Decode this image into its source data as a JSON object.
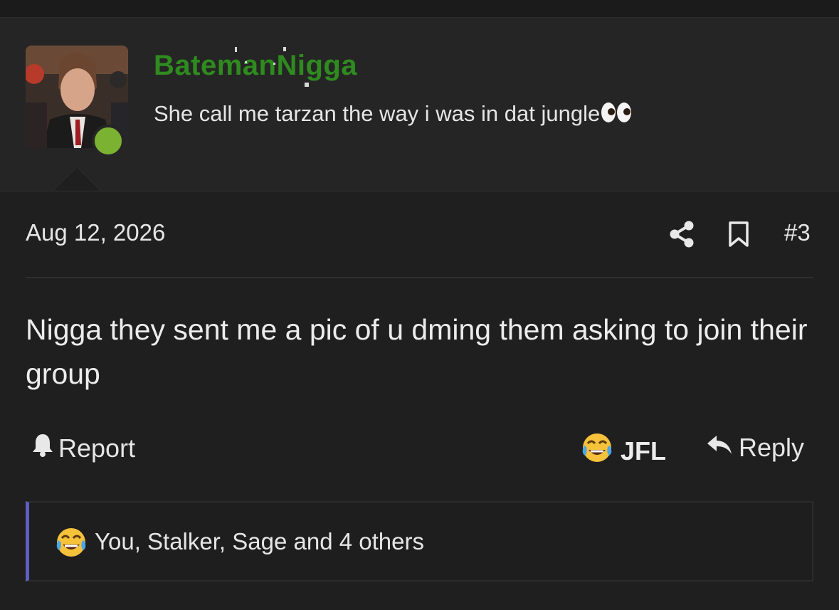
{
  "author": {
    "username": "BatemanNigga",
    "signature": "She call me tarzan the way i was in dat jungle",
    "signature_emoji": "eyes-icon",
    "online": true
  },
  "post": {
    "date": "Aug 12, 2026",
    "number": "#3",
    "body": "Nigga they sent me a pic of u dming them asking to join their group"
  },
  "actions": {
    "report_label": "Report",
    "reaction_label": "JFL",
    "reply_label": "Reply"
  },
  "reactions": {
    "summary": "You, Stalker, Sage and 4 others",
    "icon": "crying-laughing-emoji"
  },
  "colors": {
    "username": "#2f8a1f",
    "online_dot": "#7cb232",
    "reaction_accent": "#5e5fbd",
    "background": "#1f1f1f"
  }
}
